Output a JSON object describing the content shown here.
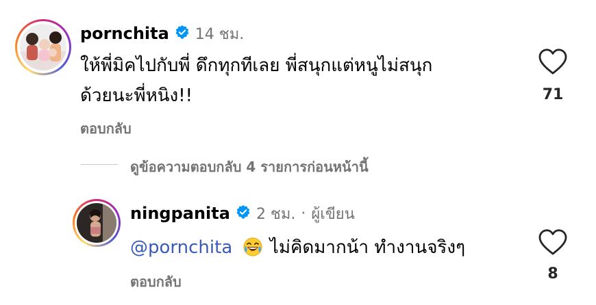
{
  "colors": {
    "mention": "#3a5bb8",
    "muted": "#737373",
    "verified": "#0095f6"
  },
  "comment1": {
    "username": "pornchita",
    "time": "14 ชม.",
    "text_line1": "ให้พี่มิคไปกับพี่ ดึกทุกทีเลย พี่สนุกแต่หนูไม่สนุก",
    "text_line2": "ด้วยนะพี่หนิง!!",
    "reply_label": "ตอบกลับ",
    "like_count": "71",
    "icons": [
      "verified-badge-icon",
      "heart-icon"
    ]
  },
  "view_replies": "ดูข้อความตอบกลับ 4 รายการก่อนหน้านี้",
  "comment2": {
    "username": "ningpanita",
    "time": "2 ชม.",
    "separator": "·",
    "author_label": "ผู้เขียน",
    "mention": "@pornchita",
    "emoji": "😂",
    "text": "ไม่คิดมากน้า ทำงานจริงๆ",
    "reply_label": "ตอบกลับ",
    "like_count": "8",
    "icons": [
      "verified-badge-icon",
      "heart-icon"
    ]
  }
}
